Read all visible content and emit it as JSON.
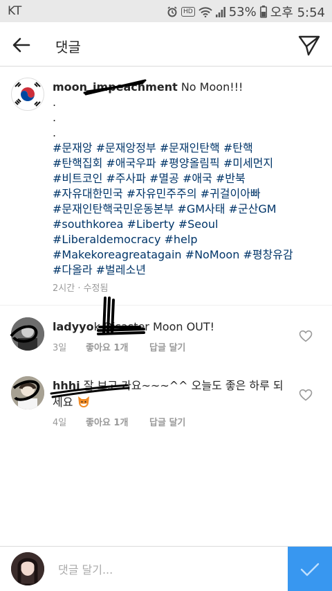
{
  "status_bar": {
    "carrier": "KT",
    "hd": "HD",
    "battery_pct": "53%",
    "time": "오후 5:54"
  },
  "header": {
    "title": "댓글"
  },
  "post": {
    "username": "moon_impeachment",
    "caption_text": " No Moon!!!",
    "dots": [
      ".",
      ".",
      "."
    ],
    "hashtag_lines": [
      "#문재앙 #문재앙정부 #문재인탄핵 #탄핵",
      "#탄핵집회 #애국우파 #평양올림픽 #미세먼지",
      "#비트코인 #주사파 #멸공 #애국 #반북",
      "#자유대한민국 #자유민주주의 #귀걸이아빠",
      "#문재인탄핵국민운동본부 #GM사태 #군산GM",
      "#southkorea #Liberty #Seoul",
      "#Liberaldemocracy #help",
      "#Makekoreagreatagain #NoMoon #평창유감",
      "#다올라 #벌레소년"
    ],
    "meta": "2시간 · 수정됨"
  },
  "comments": [
    {
      "username": "ladyyo",
      "text": "k Disaster Moon OUT!",
      "age": "3일",
      "likes": "좋아요 1개",
      "reply": "답글 달기"
    },
    {
      "username": "hhhi",
      "text": "잘 보고 가요~~~^^ 오늘도 좋은 하루 되세요",
      "age": "4일",
      "likes": "좋아요 1개",
      "reply": "답글 달기"
    }
  ],
  "composer": {
    "placeholder": "댓글 달기..."
  }
}
